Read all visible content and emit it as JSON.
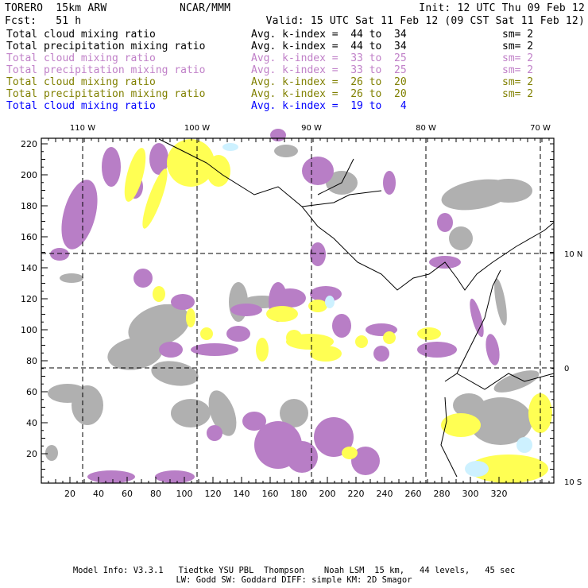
{
  "header": {
    "model": "TORERO  15km ARW",
    "org": "NCAR/MMM",
    "init": "Init: 12 UTC Thu 09 Feb 12",
    "fcst": "Fcst:   51 h",
    "valid": "Valid: 15 UTC Sat 11 Feb 12 (09 CST Sat 11 Feb 12)"
  },
  "legend": [
    {
      "field": "Total cloud mixing ratio",
      "kindex": "Avg. k-index =  44 to  34",
      "sm": "sm= 2",
      "color": "#000000"
    },
    {
      "field": "Total precipitation mixing ratio",
      "kindex": "Avg. k-index =  44 to  34",
      "sm": "sm= 2",
      "color": "#000000"
    },
    {
      "field": "Total cloud mixing ratio",
      "kindex": "Avg. k-index =  33 to  25",
      "sm": "sm= 2",
      "color": "#c080c8"
    },
    {
      "field": "Total precipitation mixing ratio",
      "kindex": "Avg. k-index =  33 to  25",
      "sm": "sm= 2",
      "color": "#c080c8"
    },
    {
      "field": "Total cloud mixing ratio",
      "kindex": "Avg. k-index =  26 to  20",
      "sm": "sm= 2",
      "color": "#808000"
    },
    {
      "field": "Total precipitation mixing ratio",
      "kindex": "Avg. k-index =  26 to  20",
      "sm": "sm= 2",
      "color": "#808000"
    },
    {
      "field": "Total cloud mixing ratio",
      "kindex": "Avg. k-index =  19 to   4",
      "sm": "",
      "color": "#0000ff"
    }
  ],
  "chart_data": {
    "type": "heatmap",
    "title": "Total cloud / precipitation mixing ratio by k-index layer",
    "xlim": [
      0,
      358
    ],
    "ylim": [
      1.5,
      224
    ],
    "x_ticks": [
      20,
      40,
      60,
      80,
      100,
      120,
      140,
      160,
      180,
      200,
      220,
      240,
      260,
      280,
      300,
      320
    ],
    "y_ticks": [
      20,
      40,
      60,
      80,
      100,
      120,
      140,
      160,
      180,
      200,
      220
    ],
    "lon_lines": [
      {
        "x": 40,
        "label": "110 W"
      },
      {
        "x": 120,
        "label": "100 W"
      },
      {
        "x": 200,
        "label": "90 W"
      },
      {
        "x": 280,
        "label": "80 W"
      },
      {
        "x": 360,
        "label": "70 W"
      }
    ],
    "lat_lines": [
      {
        "y": 150,
        "label": "10 N"
      },
      {
        "y": 76,
        "label": "0"
      },
      {
        "y": 2,
        "label": "10 S"
      }
    ],
    "colors": {
      "gray": "#a8a8a8",
      "purple": "#b070c0",
      "yellow": "#ffff40",
      "lightblue": "#c8f0ff"
    }
  },
  "footer": {
    "line1": "Model Info: V3.3.1   Tiedtke YSU PBL  Thompson    Noah LSM  15 km,   44 levels,   45 sec",
    "line2": "LW: Godd SW: Goddard DIFF: simple KM: 2D Smagor"
  }
}
